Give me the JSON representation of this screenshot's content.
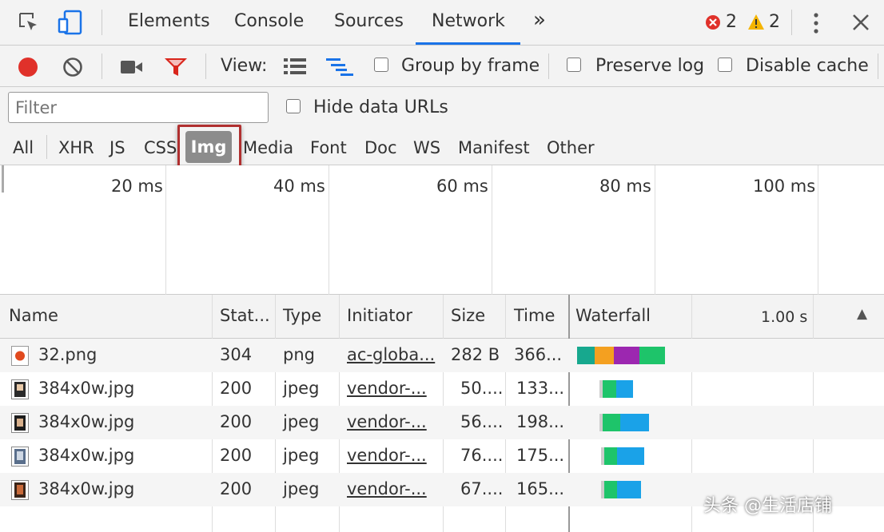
{
  "tabs": [
    "Elements",
    "Console",
    "Sources",
    "Network"
  ],
  "more_tabs_label": "»",
  "errors_count": "2",
  "warnings_count": "2",
  "toolbar": {
    "view_label": "View:",
    "group_by_frame": "Group by frame",
    "preserve_log": "Preserve log",
    "disable_cache": "Disable cache"
  },
  "filter": {
    "placeholder": "Filter",
    "hide_data_urls": "Hide data URLs"
  },
  "types": [
    "All",
    "XHR",
    "JS",
    "CSS",
    "Img",
    "Media",
    "Font",
    "Doc",
    "WS",
    "Manifest",
    "Other"
  ],
  "active_type": "Img",
  "overview_ticks": [
    "20 ms",
    "40 ms",
    "60 ms",
    "80 ms",
    "100 ms"
  ],
  "columns": [
    "Name",
    "Stat...",
    "Type",
    "Initiator",
    "Size",
    "Time",
    "Waterfall",
    "1.00 s"
  ],
  "sort_arrow": "▲",
  "rows": [
    {
      "name": "32.png",
      "status": "304",
      "type": "png",
      "initiator": "ac-globa...",
      "size": "282 B",
      "time": "366...",
      "icon": "favicon-icon"
    },
    {
      "name": "384x0w.jpg",
      "status": "200",
      "type": "jpeg",
      "initiator": "vendor-...",
      "size": "50....",
      "time": "133...",
      "icon": "image-thumb-icon"
    },
    {
      "name": "384x0w.jpg",
      "status": "200",
      "type": "jpeg",
      "initiator": "vendor-...",
      "size": "56....",
      "time": "198...",
      "icon": "image-thumb-icon"
    },
    {
      "name": "384x0w.jpg",
      "status": "200",
      "type": "jpeg",
      "initiator": "vendor-...",
      "size": "76....",
      "time": "175...",
      "icon": "image-thumb-icon"
    },
    {
      "name": "384x0w.jpg",
      "status": "200",
      "type": "jpeg",
      "initiator": "vendor-...",
      "size": "67....",
      "time": "165...",
      "icon": "image-thumb-icon"
    }
  ],
  "watermark": "头条 @生活店铺",
  "colors": {
    "record": "#e0312a",
    "filter_icon": "#d9261c",
    "active_tab_underline": "#1a73e8",
    "waterfall_teal": "#17a88e",
    "waterfall_orange": "#f4a020",
    "waterfall_purple": "#9c27b0",
    "waterfall_green": "#1ec46a",
    "waterfall_blue": "#1aa2e8"
  }
}
